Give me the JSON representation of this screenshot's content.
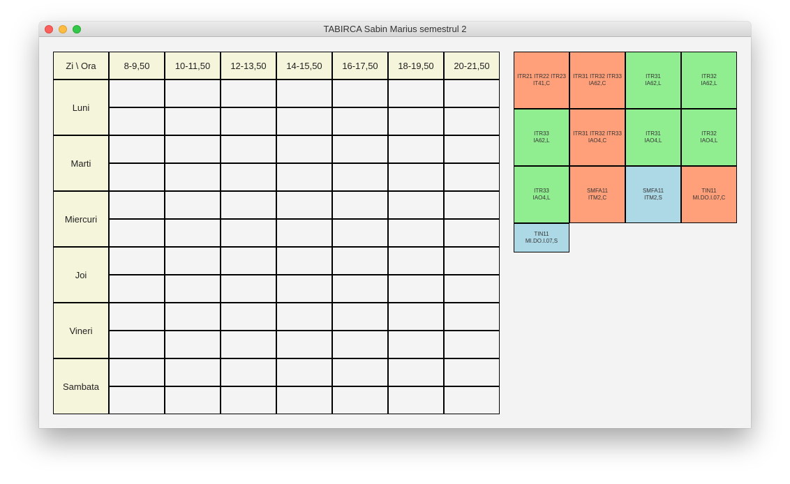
{
  "window": {
    "title": "TABIRCA Sabin Marius semestrul 2"
  },
  "header": {
    "corner": "Zi \\ Ora",
    "slots": [
      "8-9,50",
      "10-11,50",
      "12-13,50",
      "14-15,50",
      "16-17,50",
      "18-19,50",
      "20-21,50"
    ]
  },
  "days": [
    "Luni",
    "Marti",
    "Miercuri",
    "Joi",
    "Vineri",
    "Sambata"
  ],
  "colors": {
    "course": "#ffa07a",
    "lab": "#90ee90",
    "seminar": "#add8e6",
    "header_bg": "#f5f5dc",
    "slot_bg": "#f4f4f4"
  },
  "tiles": [
    {
      "line1": "ITR21 ITR22 ITR23",
      "line2": "IT41,C",
      "kind": "course"
    },
    {
      "line1": "ITR31 ITR32 ITR33",
      "line2": "IA62,C",
      "kind": "course"
    },
    {
      "line1": "ITR31",
      "line2": "IA62,L",
      "kind": "lab"
    },
    {
      "line1": "ITR32",
      "line2": "IA62,L",
      "kind": "lab"
    },
    {
      "line1": "ITR33",
      "line2": "IA62,L",
      "kind": "lab"
    },
    {
      "line1": "ITR31 ITR32 ITR33",
      "line2": "IAO4,C",
      "kind": "course"
    },
    {
      "line1": "ITR31",
      "line2": "IAO4,L",
      "kind": "lab"
    },
    {
      "line1": "ITR32",
      "line2": "IAO4,L",
      "kind": "lab"
    },
    {
      "line1": "ITR33",
      "line2": "IAO4,L",
      "kind": "lab"
    },
    {
      "line1": "SMFA11",
      "line2": "ITM2,C",
      "kind": "course"
    },
    {
      "line1": "SMFA11",
      "line2": "ITM2,S",
      "kind": "seminar"
    },
    {
      "line1": "TIN11",
      "line2": "MI.DO.I.07,C",
      "kind": "course"
    },
    {
      "line1": "TIN11",
      "line2": "MI.DO.I.07,S",
      "kind": "seminar"
    }
  ]
}
